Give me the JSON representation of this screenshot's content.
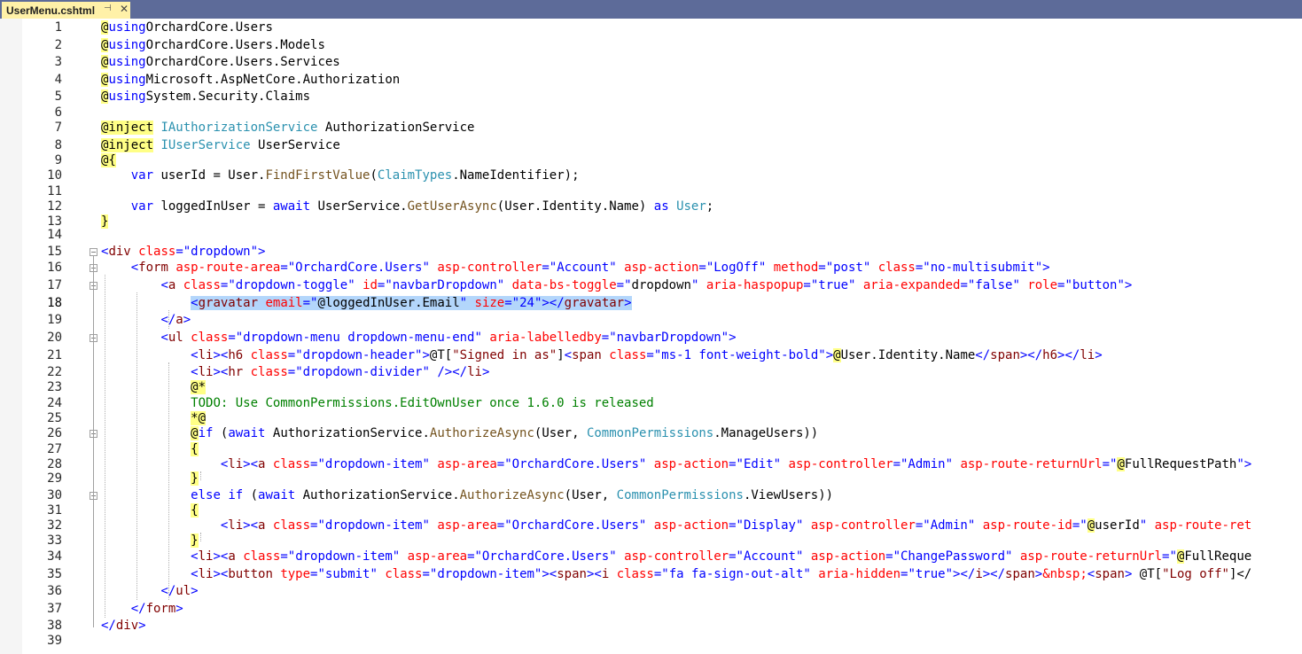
{
  "tab": {
    "title": "UserMenu.cshtml",
    "pin_glyph": "⊣",
    "close_glyph": "✕"
  },
  "lines": [
    {
      "n": "1",
      "fold": false,
      "tokens": [
        [
          "r",
          "@"
        ],
        [
          "k",
          "using"
        ],
        [
          "",
          "OrchardCore.Users"
        ]
      ]
    },
    {
      "n": "2",
      "fold": false,
      "tokens": [
        [
          "r",
          "@"
        ],
        [
          "k",
          "using"
        ],
        [
          "",
          "OrchardCore.Users.Models"
        ]
      ]
    },
    {
      "n": "3",
      "fold": false,
      "tokens": [
        [
          "r",
          "@"
        ],
        [
          "k",
          "using"
        ],
        [
          "",
          "OrchardCore.Users.Services"
        ]
      ]
    },
    {
      "n": "4",
      "fold": false,
      "tokens": [
        [
          "r",
          "@"
        ],
        [
          "k",
          "using"
        ],
        [
          "",
          "Microsoft.AspNetCore.Authorization"
        ]
      ]
    },
    {
      "n": "5",
      "fold": false,
      "tokens": [
        [
          "r",
          "@"
        ],
        [
          "k",
          "using"
        ],
        [
          "",
          "System.Security.Claims"
        ]
      ]
    },
    {
      "n": "6",
      "fold": false,
      "tokens": []
    },
    {
      "n": "7",
      "fold": false,
      "tokens": [
        [
          "r",
          "@inject"
        ],
        [
          "",
          " "
        ],
        [
          "y",
          "IAuthorizationService"
        ],
        [
          "",
          " AuthorizationService"
        ]
      ]
    },
    {
      "n": "8",
      "fold": false,
      "tokens": [
        [
          "r",
          "@inject"
        ],
        [
          "",
          " "
        ],
        [
          "y",
          "IUserService"
        ],
        [
          "",
          " UserService"
        ]
      ]
    },
    {
      "n": "9",
      "fold": false,
      "tokens": [
        [
          "r",
          "@{"
        ]
      ]
    },
    {
      "n": "10",
      "fold": false,
      "tokens": [
        [
          "",
          "    "
        ],
        [
          "k",
          "var"
        ],
        [
          "",
          " userId = User."
        ],
        [
          "m",
          "FindFirstValue"
        ],
        [
          "",
          "("
        ],
        [
          "y",
          "ClaimTypes"
        ],
        [
          "",
          ".NameIdentifier);"
        ]
      ]
    },
    {
      "n": "11",
      "fold": false,
      "tokens": []
    },
    {
      "n": "12",
      "fold": false,
      "tokens": [
        [
          "",
          "    "
        ],
        [
          "k",
          "var"
        ],
        [
          "",
          " loggedInUser = "
        ],
        [
          "k",
          "await"
        ],
        [
          "",
          " UserService."
        ],
        [
          "m",
          "GetUserAsync"
        ],
        [
          "",
          "(User.Identity.Name) "
        ],
        [
          "k",
          "as"
        ],
        [
          "",
          " "
        ],
        [
          "y",
          "User"
        ],
        [
          "",
          ";"
        ]
      ]
    },
    {
      "n": "13",
      "fold": false,
      "tokens": [
        [
          "r",
          "}"
        ]
      ]
    },
    {
      "n": "14",
      "fold": false,
      "tokens": []
    },
    {
      "n": "15",
      "fold": true,
      "tokens": [
        [
          "p",
          "<"
        ],
        [
          "t",
          "div"
        ],
        [
          "",
          " "
        ],
        [
          "a",
          "class"
        ],
        [
          "p",
          "=\"dropdown\">"
        ]
      ]
    },
    {
      "n": "16",
      "fold": true,
      "tokens": [
        [
          "",
          "    "
        ],
        [
          "p",
          "<"
        ],
        [
          "t",
          "form"
        ],
        [
          "",
          " "
        ],
        [
          "a",
          "asp-route-area"
        ],
        [
          "p",
          "=\"OrchardCore.Users\""
        ],
        [
          "",
          " "
        ],
        [
          "a",
          "asp-controller"
        ],
        [
          "p",
          "=\"Account\""
        ],
        [
          "",
          " "
        ],
        [
          "a",
          "asp-action"
        ],
        [
          "p",
          "=\"LogOff\""
        ],
        [
          "",
          " "
        ],
        [
          "a",
          "method"
        ],
        [
          "p",
          "=\"post\""
        ],
        [
          "",
          " "
        ],
        [
          "a",
          "class"
        ],
        [
          "p",
          "=\"no-multisubmit\">"
        ]
      ]
    },
    {
      "n": "17",
      "fold": true,
      "tokens": [
        [
          "",
          "        "
        ],
        [
          "p",
          "<"
        ],
        [
          "t",
          "a"
        ],
        [
          "",
          " "
        ],
        [
          "a",
          "class"
        ],
        [
          "p",
          "=\"dropdown-toggle\""
        ],
        [
          "",
          " "
        ],
        [
          "a",
          "id"
        ],
        [
          "p",
          "=\"navbarDropdown\""
        ],
        [
          "",
          " "
        ],
        [
          "a",
          "data-bs-toggle"
        ],
        [
          "p",
          "=\""
        ],
        [
          "",
          "dropdown"
        ],
        [
          "p",
          "\""
        ],
        [
          "",
          " "
        ],
        [
          "a",
          "aria-haspopup"
        ],
        [
          "p",
          "=\"true\""
        ],
        [
          "",
          " "
        ],
        [
          "a",
          "aria-expanded"
        ],
        [
          "p",
          "=\"false\""
        ],
        [
          "",
          " "
        ],
        [
          "a",
          "role"
        ],
        [
          "p",
          "=\"button\">"
        ]
      ]
    },
    {
      "n": "18",
      "fold": false,
      "tokens": [
        [
          "",
          "            "
        ],
        [
          "sp",
          "<"
        ],
        [
          "st",
          "gravatar"
        ],
        [
          "s",
          " "
        ],
        [
          "sa",
          "email"
        ],
        [
          "sp",
          "=\""
        ],
        [
          "sr",
          "@"
        ],
        [
          "s",
          "loggedInUser.Email"
        ],
        [
          "sp",
          "\""
        ],
        [
          "s",
          " "
        ],
        [
          "sa",
          "size"
        ],
        [
          "sp",
          "=\"24\"></"
        ],
        [
          "st",
          "gravatar"
        ],
        [
          "sp",
          ">"
        ]
      ]
    },
    {
      "n": "19",
      "fold": false,
      "tokens": [
        [
          "",
          "        "
        ],
        [
          "p",
          "</"
        ],
        [
          "t",
          "a"
        ],
        [
          "p",
          ">"
        ]
      ]
    },
    {
      "n": "20",
      "fold": true,
      "tokens": [
        [
          "",
          "        "
        ],
        [
          "p",
          "<"
        ],
        [
          "t",
          "ul"
        ],
        [
          "",
          " "
        ],
        [
          "a",
          "class"
        ],
        [
          "p",
          "=\"dropdown-menu dropdown-menu-end\""
        ],
        [
          "",
          " "
        ],
        [
          "a",
          "aria-labelledby"
        ],
        [
          "p",
          "=\"navbarDropdown\">"
        ]
      ]
    },
    {
      "n": "21",
      "fold": false,
      "tokens": [
        [
          "",
          "            "
        ],
        [
          "p",
          "<"
        ],
        [
          "t",
          "li"
        ],
        [
          "p",
          "><"
        ],
        [
          "t",
          "h6"
        ],
        [
          "",
          " "
        ],
        [
          "a",
          "class"
        ],
        [
          "p",
          "=\"dropdown-header\">"
        ],
        [
          "",
          "@T["
        ],
        [
          "t",
          "\"Signed in as\""
        ],
        [
          "",
          "]"
        ],
        [
          "p",
          "<"
        ],
        [
          "t",
          "span"
        ],
        [
          "",
          " "
        ],
        [
          "a",
          "class"
        ],
        [
          "p",
          "=\"ms-1 font-weight-bold\">"
        ],
        [
          "r",
          "@"
        ],
        [
          "",
          "User.Identity.Name"
        ],
        [
          "p",
          "</"
        ],
        [
          "t",
          "span"
        ],
        [
          "p",
          "></"
        ],
        [
          "t",
          "h6"
        ],
        [
          "p",
          "></"
        ],
        [
          "t",
          "li"
        ],
        [
          "p",
          ">"
        ]
      ]
    },
    {
      "n": "22",
      "fold": false,
      "tokens": [
        [
          "",
          "            "
        ],
        [
          "p",
          "<"
        ],
        [
          "t",
          "li"
        ],
        [
          "p",
          "><"
        ],
        [
          "t",
          "hr"
        ],
        [
          "",
          " "
        ],
        [
          "a",
          "class"
        ],
        [
          "p",
          "=\"dropdown-divider\""
        ],
        [
          "",
          " "
        ],
        [
          "p",
          "/></"
        ],
        [
          "t",
          "li"
        ],
        [
          "p",
          ">"
        ]
      ]
    },
    {
      "n": "23",
      "fold": false,
      "tokens": [
        [
          "",
          "            "
        ],
        [
          "r",
          "@*"
        ]
      ]
    },
    {
      "n": "24",
      "fold": false,
      "tokens": [
        [
          "",
          "            "
        ],
        [
          "c",
          "TODO: Use CommonPermissions.EditOwnUser once 1.6.0 is released"
        ]
      ]
    },
    {
      "n": "25",
      "fold": false,
      "tokens": [
        [
          "",
          "            "
        ],
        [
          "r",
          "*@"
        ]
      ]
    },
    {
      "n": "26",
      "fold": true,
      "tokens": [
        [
          "",
          "            "
        ],
        [
          "r",
          "@"
        ],
        [
          "k",
          "if"
        ],
        [
          "",
          " ("
        ],
        [
          "k",
          "await"
        ],
        [
          "",
          " AuthorizationService."
        ],
        [
          "m",
          "AuthorizeAsync"
        ],
        [
          "",
          "(User, "
        ],
        [
          "y",
          "CommonPermissions"
        ],
        [
          "",
          ".ManageUsers))"
        ]
      ]
    },
    {
      "n": "27",
      "fold": false,
      "tokens": [
        [
          "",
          "            "
        ],
        [
          "r",
          "{"
        ]
      ]
    },
    {
      "n": "28",
      "fold": false,
      "tokens": [
        [
          "",
          "                "
        ],
        [
          "p",
          "<"
        ],
        [
          "t",
          "li"
        ],
        [
          "p",
          "><"
        ],
        [
          "t",
          "a"
        ],
        [
          "",
          " "
        ],
        [
          "a",
          "class"
        ],
        [
          "p",
          "=\"dropdown-item\""
        ],
        [
          "",
          " "
        ],
        [
          "a",
          "asp-area"
        ],
        [
          "p",
          "=\"OrchardCore.Users\""
        ],
        [
          "",
          " "
        ],
        [
          "a",
          "asp-action"
        ],
        [
          "p",
          "=\"Edit\""
        ],
        [
          "",
          " "
        ],
        [
          "a",
          "asp-controller"
        ],
        [
          "p",
          "=\"Admin\""
        ],
        [
          "",
          " "
        ],
        [
          "a",
          "asp-route-returnUrl"
        ],
        [
          "p",
          "=\""
        ],
        [
          "r",
          "@"
        ],
        [
          "",
          "FullRequestPath"
        ],
        [
          "p",
          "\">"
        ]
      ]
    },
    {
      "n": "29",
      "fold": false,
      "tokens": [
        [
          "",
          "            "
        ],
        [
          "r",
          "}"
        ]
      ]
    },
    {
      "n": "30",
      "fold": true,
      "tokens": [
        [
          "",
          "            "
        ],
        [
          "k",
          "else"
        ],
        [
          "",
          " "
        ],
        [
          "k",
          "if"
        ],
        [
          "",
          " ("
        ],
        [
          "k",
          "await"
        ],
        [
          "",
          " AuthorizationService."
        ],
        [
          "m",
          "AuthorizeAsync"
        ],
        [
          "",
          "(User, "
        ],
        [
          "y",
          "CommonPermissions"
        ],
        [
          "",
          ".ViewUsers))"
        ]
      ]
    },
    {
      "n": "31",
      "fold": false,
      "tokens": [
        [
          "",
          "            "
        ],
        [
          "r",
          "{"
        ]
      ]
    },
    {
      "n": "32",
      "fold": false,
      "tokens": [
        [
          "",
          "                "
        ],
        [
          "p",
          "<"
        ],
        [
          "t",
          "li"
        ],
        [
          "p",
          "><"
        ],
        [
          "t",
          "a"
        ],
        [
          "",
          " "
        ],
        [
          "a",
          "class"
        ],
        [
          "p",
          "=\"dropdown-item\""
        ],
        [
          "",
          " "
        ],
        [
          "a",
          "asp-area"
        ],
        [
          "p",
          "=\"OrchardCore.Users\""
        ],
        [
          "",
          " "
        ],
        [
          "a",
          "asp-action"
        ],
        [
          "p",
          "=\"Display\""
        ],
        [
          "",
          " "
        ],
        [
          "a",
          "asp-controller"
        ],
        [
          "p",
          "=\"Admin\""
        ],
        [
          "",
          " "
        ],
        [
          "a",
          "asp-route-id"
        ],
        [
          "p",
          "=\""
        ],
        [
          "r",
          "@"
        ],
        [
          "",
          "userId"
        ],
        [
          "p",
          "\""
        ],
        [
          "",
          " "
        ],
        [
          "a",
          "asp-route-ret"
        ]
      ]
    },
    {
      "n": "33",
      "fold": false,
      "tokens": [
        [
          "",
          "            "
        ],
        [
          "r",
          "}"
        ]
      ]
    },
    {
      "n": "34",
      "fold": false,
      "tokens": [
        [
          "",
          "            "
        ],
        [
          "p",
          "<"
        ],
        [
          "t",
          "li"
        ],
        [
          "p",
          "><"
        ],
        [
          "t",
          "a"
        ],
        [
          "",
          " "
        ],
        [
          "a",
          "class"
        ],
        [
          "p",
          "=\"dropdown-item\""
        ],
        [
          "",
          " "
        ],
        [
          "a",
          "asp-area"
        ],
        [
          "p",
          "=\"OrchardCore.Users\""
        ],
        [
          "",
          " "
        ],
        [
          "a",
          "asp-controller"
        ],
        [
          "p",
          "=\"Account\""
        ],
        [
          "",
          " "
        ],
        [
          "a",
          "asp-action"
        ],
        [
          "p",
          "=\"ChangePassword\""
        ],
        [
          "",
          " "
        ],
        [
          "a",
          "asp-route-returnUrl"
        ],
        [
          "p",
          "=\""
        ],
        [
          "r",
          "@"
        ],
        [
          "",
          "FullReque"
        ]
      ]
    },
    {
      "n": "35",
      "fold": false,
      "tokens": [
        [
          "",
          "            "
        ],
        [
          "p",
          "<"
        ],
        [
          "t",
          "li"
        ],
        [
          "p",
          "><"
        ],
        [
          "t",
          "button"
        ],
        [
          "",
          " "
        ],
        [
          "a",
          "type"
        ],
        [
          "p",
          "=\"submit\""
        ],
        [
          "",
          " "
        ],
        [
          "a",
          "class"
        ],
        [
          "p",
          "=\"dropdown-item\">"
        ],
        [
          "p",
          "<"
        ],
        [
          "t",
          "span"
        ],
        [
          "p",
          "><"
        ],
        [
          "t",
          "i"
        ],
        [
          "",
          " "
        ],
        [
          "a",
          "class"
        ],
        [
          "p",
          "=\"fa fa-sign-out-alt\""
        ],
        [
          "",
          " "
        ],
        [
          "a",
          "aria-hidden"
        ],
        [
          "p",
          "=\"true\"></"
        ],
        [
          "t",
          "i"
        ],
        [
          "p",
          "></"
        ],
        [
          "t",
          "span"
        ],
        [
          "p",
          ">"
        ],
        [
          "a",
          "&nbsp;"
        ],
        [
          "p",
          "<"
        ],
        [
          "t",
          "span"
        ],
        [
          "p",
          ">"
        ],
        [
          "",
          " @T["
        ],
        [
          "t",
          "\"Log off\""
        ],
        [
          "",
          "]</"
        ]
      ]
    },
    {
      "n": "36",
      "fold": false,
      "tokens": [
        [
          "",
          "        "
        ],
        [
          "p",
          "</"
        ],
        [
          "t",
          "ul"
        ],
        [
          "p",
          ">"
        ]
      ]
    },
    {
      "n": "37",
      "fold": false,
      "tokens": [
        [
          "",
          "    "
        ],
        [
          "p",
          "</"
        ],
        [
          "t",
          "form"
        ],
        [
          "p",
          ">"
        ]
      ]
    },
    {
      "n": "38",
      "fold": false,
      "tokens": [
        [
          "p",
          "</"
        ],
        [
          "t",
          "div"
        ],
        [
          "p",
          ">"
        ]
      ]
    },
    {
      "n": "39",
      "fold": false,
      "tokens": []
    }
  ]
}
